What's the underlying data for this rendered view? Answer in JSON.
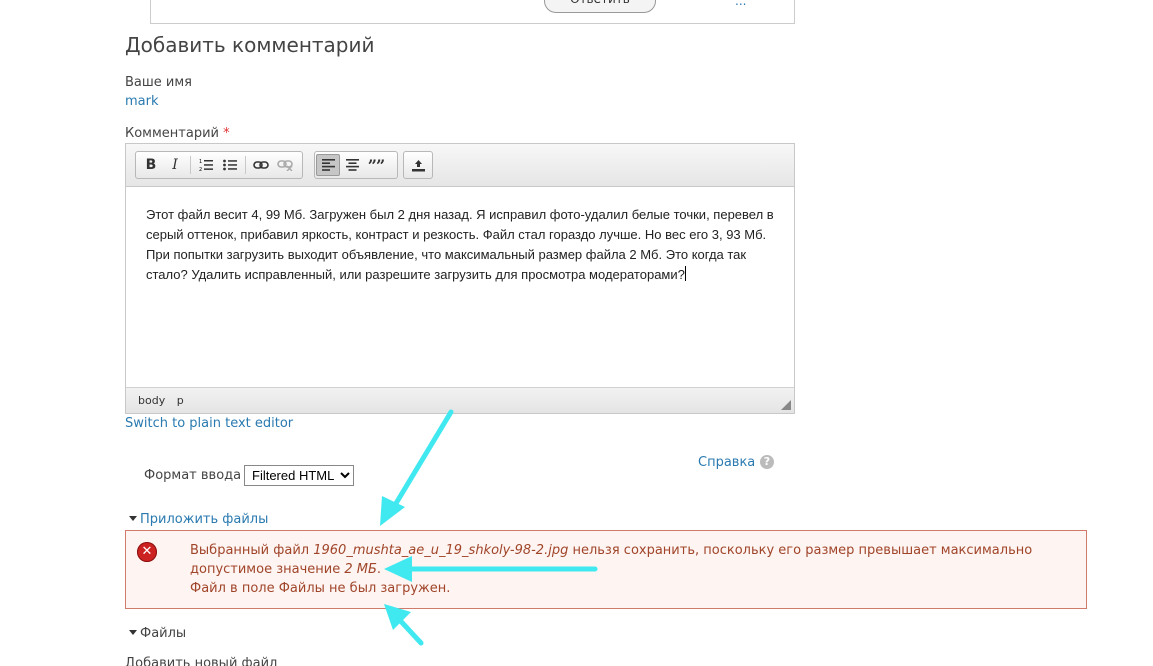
{
  "top_panel": {
    "reply_button": "Ответить",
    "link": "..."
  },
  "form": {
    "title": "Добавить комментарий",
    "name_label": "Ваше имя",
    "name_value": "mark",
    "comment_label": "Комментарий",
    "required_mark": "*",
    "editor": {
      "toolbar": {
        "bold": "B",
        "italic": "I",
        "numbered_list": "1≡",
        "bullet_list": "•≡",
        "link": "⛓",
        "unlink": "⛓",
        "align_left": "≡",
        "align_center": "≡",
        "blockquote": "99",
        "upload": "⇧"
      },
      "content": "Этот файл весит  4, 99 Мб.  Загружен был 2 дня назад.  Я исправил фото-удалил белые точки, перевел в серый оттенок, прибавил яркость, контраст и резкость. Файл стал гораздо лучше. Но вес его 3, 93 Мб. При попытки загрузить выходит объявление, что максимальный размер файла 2 Мб. Это когда так стало?  Удалить исправленный, или разрешите загрузить для просмотра модераторами?",
      "path": [
        "body",
        "p"
      ]
    },
    "switch_editor_link": "Switch to plain text editor",
    "format_label": "Формат ввода",
    "format_selected": "Filtered HTML",
    "help_link": "Справка",
    "help_icon": "?",
    "attach_section": "Приложить файлы",
    "error": {
      "icon": "✕",
      "line1_prefix": "Выбранный файл ",
      "filename": "1960_mushta_ae_u_19_shkoly-98-2.jpg",
      "line1_suffix": " нельзя сохранить, поскольку его размер превышает максимально",
      "line2_prefix": "допустимое значение ",
      "max_size": "2 МБ",
      "line2_suffix": ".",
      "line3": "Файл в поле Файлы не был загружен."
    },
    "files_section": "Файлы",
    "add_new_file_label": "Добавить новый файл"
  },
  "colors": {
    "link": "#2a7ab0",
    "error_text": "#a0452a",
    "error_border": "#d07a6a",
    "arrow": "#40e8f0"
  }
}
